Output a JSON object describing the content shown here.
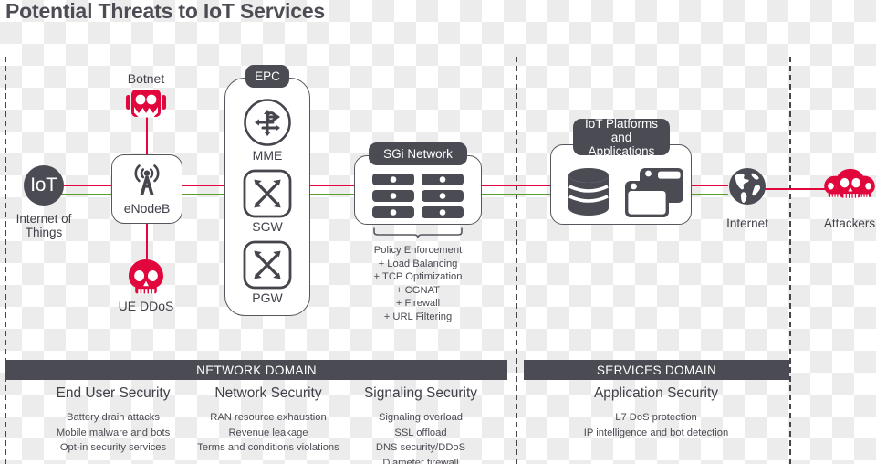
{
  "title": "Potential Threats to IoT Services",
  "colors": {
    "red": "#e1073c",
    "green": "#5a9e2f",
    "dark": "#4a4b53",
    "text": "#3f4048"
  },
  "nodes": {
    "iot": {
      "badge": "IoT",
      "caption": "Internet of\nThings"
    },
    "botnet": {
      "label": "Botnet",
      "icon": "robot-icon"
    },
    "enodeb": {
      "label": "eNodeB",
      "icon": "cell-tower-icon"
    },
    "ue_ddos": {
      "label": "UE DDoS",
      "icon": "skull-icon"
    },
    "epc": {
      "badge": "EPC",
      "items": [
        {
          "label": "MME",
          "icon": "router-circle-icon"
        },
        {
          "label": "SGW",
          "icon": "switch-icon"
        },
        {
          "label": "PGW",
          "icon": "switch-icon"
        }
      ]
    },
    "sgi": {
      "badge": "SGi Network",
      "icon": "server-rack-icon"
    },
    "platforms": {
      "badge": "IoT Platforms\nand Applications",
      "icons": [
        "database-icon",
        "windows-icon"
      ]
    },
    "internet": {
      "caption": "Internet",
      "icon": "globe-icon"
    },
    "attackers": {
      "caption": "Attackers",
      "icon": "skulls-icon"
    }
  },
  "policy_list": [
    "Policy Enforcement",
    "+ Load Balancing",
    "+ TCP Optimization",
    "+ CGNAT",
    "+ Firewall",
    "+ URL Filtering"
  ],
  "domains": [
    {
      "bar": "NETWORK DOMAIN"
    },
    {
      "bar": "SERVICES DOMAIN"
    }
  ],
  "columns": [
    {
      "heading": "End User Security",
      "items": [
        "Battery drain attacks",
        "Mobile malware and bots",
        "Opt-in security services"
      ]
    },
    {
      "heading": "Network Security",
      "items": [
        "RAN resource exhaustion",
        "Revenue leakage",
        "Terms and conditions violations"
      ]
    },
    {
      "heading": "Signaling Security",
      "items": [
        "Signaling overload",
        "SSL offload",
        "DNS security/DDoS",
        "Diameter firewall"
      ]
    },
    {
      "heading": "Application Security",
      "items": [
        "L7 DoS protection",
        "IP intelligence and bot detection"
      ]
    }
  ]
}
